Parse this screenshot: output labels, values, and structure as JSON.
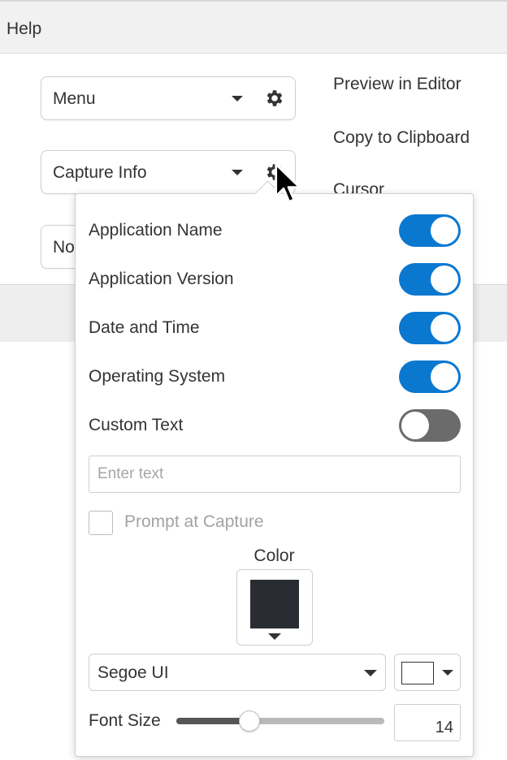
{
  "menubar": {
    "help": "Help"
  },
  "combos": {
    "menu": {
      "label": "Menu"
    },
    "capture_info": {
      "label": "Capture Info"
    },
    "third": {
      "label": "No"
    }
  },
  "options": {
    "preview": "Preview in Editor",
    "copy": "Copy to Clipboard",
    "cursor": "Cursor"
  },
  "popup": {
    "rows": [
      {
        "label": "Application Name",
        "on": true
      },
      {
        "label": "Application Version",
        "on": true
      },
      {
        "label": "Date and Time",
        "on": true
      },
      {
        "label": "Operating System",
        "on": true
      },
      {
        "label": "Custom Text",
        "on": false
      }
    ],
    "custom_text": {
      "placeholder": "Enter text",
      "value": ""
    },
    "prompt_label": "Prompt at Capture",
    "prompt_checked": false,
    "color_label": "Color",
    "text_color": "#292d33",
    "font": "Segoe UI",
    "background_color": "#ffffff",
    "font_size_label": "Font Size",
    "font_size_value": "14",
    "font_size_slider_fraction": 0.35
  },
  "colors": {
    "accent": "#0b78d0",
    "toggle_off": "#6b6b6b"
  },
  "icons": {
    "gear": "gear-icon",
    "caret": "caret-down-icon",
    "pointer": "mouse-pointer-icon"
  }
}
